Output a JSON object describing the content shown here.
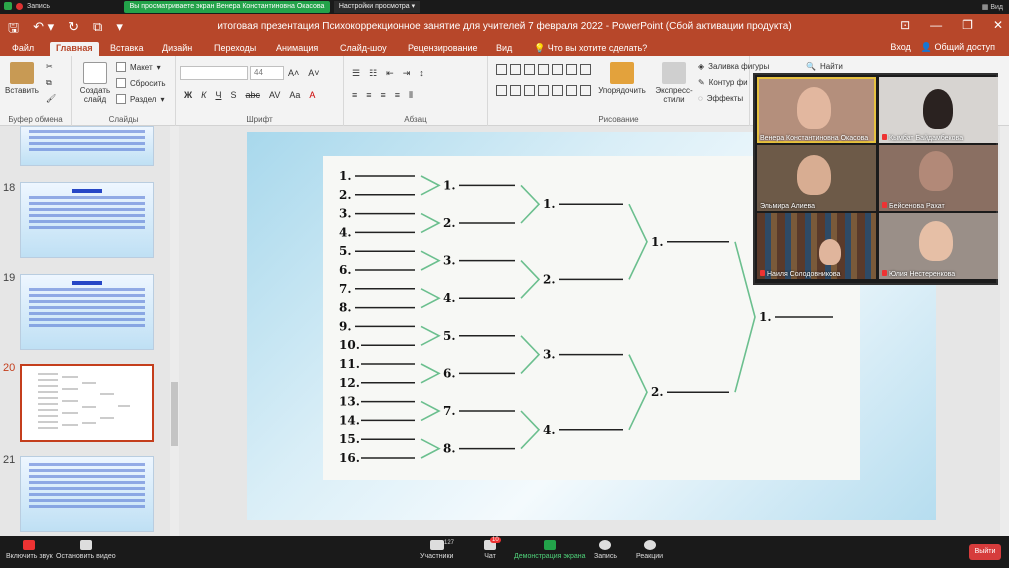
{
  "zoom_top": {
    "recording": "Запись",
    "share_banner": "Вы просматриваете экран Венера Константиновна Окасова",
    "view_settings": "Настройки просмотра",
    "view": "Вид"
  },
  "window": {
    "title": "итоговая презентация Психокоррекционное занятие для учителей 7 февраля 2022 - PowerPoint (Сбой активации продукта)"
  },
  "ribbon_tabs": [
    "Файл",
    "Главная",
    "Вставка",
    "Дизайн",
    "Переходы",
    "Анимация",
    "Слайд-шоу",
    "Рецензирование",
    "Вид"
  ],
  "active_tab": "Главная",
  "tell_me": "Что вы хотите сделать?",
  "sign_in": "Вход",
  "share": "Общий доступ",
  "ribbon": {
    "paste": "Вставить",
    "clipboard_label": "Буфер обмена",
    "new_slide": "Создать слайд",
    "layout": "Макет",
    "reset": "Сбросить",
    "section": "Раздел",
    "slides_label": "Слайды",
    "font_size": "44",
    "font_label": "Шрифт",
    "paragraph_label": "Абзац",
    "arrange": "Упорядочить",
    "quick_styles": "Экспресс-стили",
    "shape_fill": "Заливка фигуры",
    "shape_outline": "Контур фи",
    "shape_effects": "Эффекты",
    "drawing_label": "Рисование",
    "find": "Найти",
    "fmt_bold": "Ж",
    "fmt_italic": "К",
    "fmt_underline": "Ч",
    "fmt_shadow": "S",
    "fmt_strike": "abc",
    "fmt_spacing": "AV",
    "fmt_case": "Aa",
    "fmt_color": "A"
  },
  "thumbnails": [
    {
      "num": "",
      "title": ""
    },
    {
      "num": "18",
      "title": "Шаг 1"
    },
    {
      "num": "19",
      "title": "Шаг 2"
    },
    {
      "num": "20",
      "title": ""
    },
    {
      "num": "21",
      "title": ""
    }
  ],
  "slide": {
    "col1": [
      "1.",
      "2.",
      "3.",
      "4.",
      "5.",
      "6.",
      "7.",
      "8.",
      "9.",
      "10.",
      "11.",
      "12.",
      "13.",
      "14.",
      "15.",
      "16."
    ],
    "col2": [
      "1.",
      "2.",
      "3.",
      "4.",
      "5.",
      "6.",
      "7.",
      "8."
    ],
    "col3": [
      "1.",
      "2.",
      "3.",
      "4."
    ],
    "col4": [
      "1.",
      "2."
    ],
    "col5": [
      "1."
    ]
  },
  "participants": [
    {
      "name": "Венера Константиновна Окасова",
      "speaking": true
    },
    {
      "name": "Кымбат Байдамбекова",
      "speaking": false
    },
    {
      "name": "Эльмира Алиева",
      "speaking": false
    },
    {
      "name": "Бейсенова Рахат",
      "speaking": false
    },
    {
      "name": "Наиля Солодовникова",
      "speaking": false
    },
    {
      "name": "Юлия Нестеренкова",
      "speaking": false
    }
  ],
  "zoom_bar": {
    "unmute": "Включить звук",
    "stop_video": "Остановить видео",
    "participants": "Участники",
    "participants_count": "127",
    "chat": "Чат",
    "chat_badge": "10",
    "share_screen": "Демонстрация экрана",
    "record": "Запись",
    "reactions": "Реакции",
    "leave": "Выйти"
  }
}
